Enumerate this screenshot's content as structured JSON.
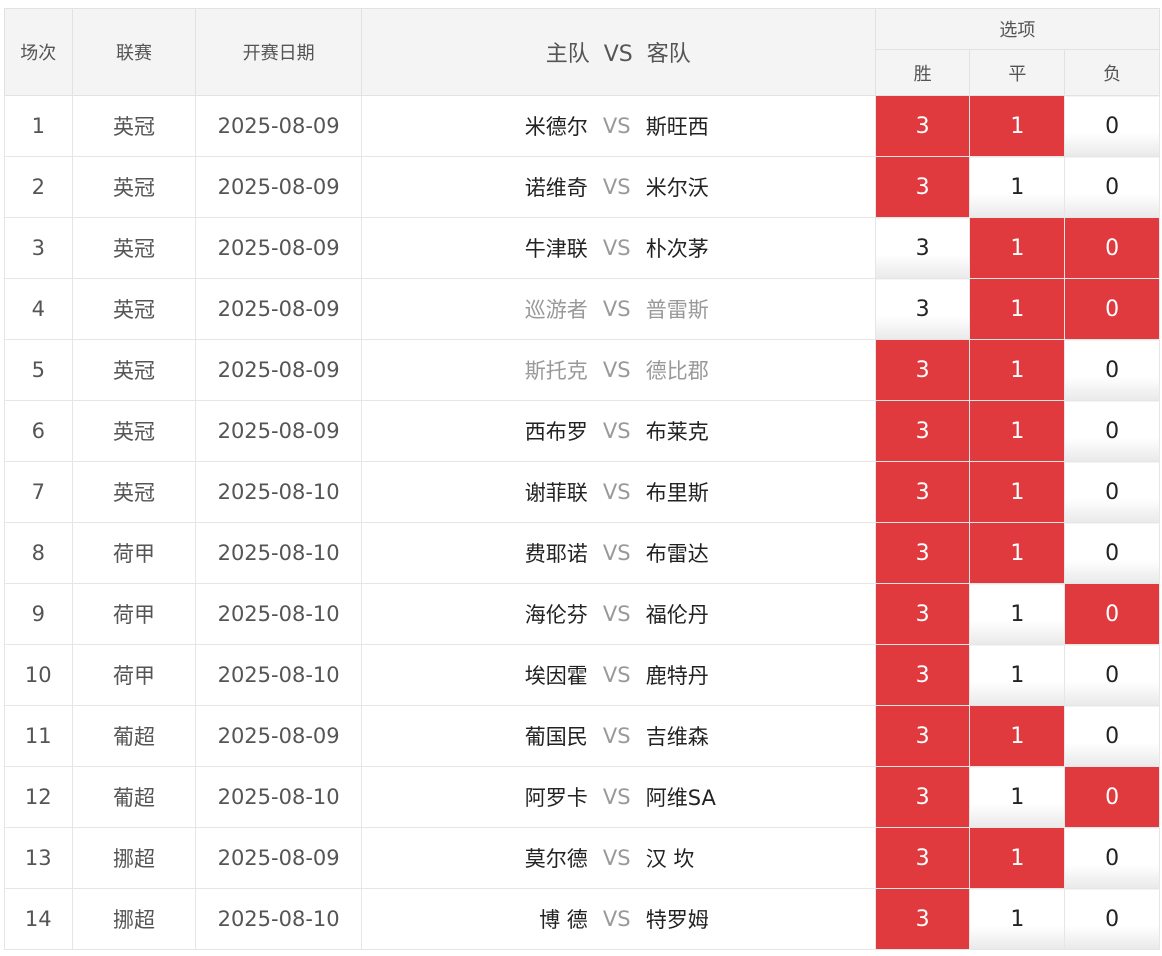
{
  "header": {
    "num": "场次",
    "league": "联赛",
    "date": "开赛日期",
    "home": "主队",
    "vs": "VS",
    "away": "客队",
    "options": "选项",
    "win": "胜",
    "draw": "平",
    "lose": "负"
  },
  "colors": {
    "selected": "#e03a3e",
    "muted": "#999999"
  },
  "rows": [
    {
      "num": "1",
      "league": "英冠",
      "date": "2025-08-09",
      "home": "米德尔",
      "away": "斯旺西",
      "muted": false,
      "w": "3",
      "d": "1",
      "l": "0",
      "sel": [
        true,
        true,
        false
      ]
    },
    {
      "num": "2",
      "league": "英冠",
      "date": "2025-08-09",
      "home": "诺维奇",
      "away": "米尔沃",
      "muted": false,
      "w": "3",
      "d": "1",
      "l": "0",
      "sel": [
        true,
        false,
        false
      ]
    },
    {
      "num": "3",
      "league": "英冠",
      "date": "2025-08-09",
      "home": "牛津联",
      "away": "朴次茅",
      "muted": false,
      "w": "3",
      "d": "1",
      "l": "0",
      "sel": [
        false,
        true,
        true
      ]
    },
    {
      "num": "4",
      "league": "英冠",
      "date": "2025-08-09",
      "home": "巡游者",
      "away": "普雷斯",
      "muted": true,
      "w": "3",
      "d": "1",
      "l": "0",
      "sel": [
        false,
        true,
        true
      ]
    },
    {
      "num": "5",
      "league": "英冠",
      "date": "2025-08-09",
      "home": "斯托克",
      "away": "德比郡",
      "muted": true,
      "w": "3",
      "d": "1",
      "l": "0",
      "sel": [
        true,
        true,
        false
      ]
    },
    {
      "num": "6",
      "league": "英冠",
      "date": "2025-08-09",
      "home": "西布罗",
      "away": "布莱克",
      "muted": false,
      "w": "3",
      "d": "1",
      "l": "0",
      "sel": [
        true,
        true,
        false
      ]
    },
    {
      "num": "7",
      "league": "英冠",
      "date": "2025-08-10",
      "home": "谢菲联",
      "away": "布里斯",
      "muted": false,
      "w": "3",
      "d": "1",
      "l": "0",
      "sel": [
        true,
        true,
        false
      ]
    },
    {
      "num": "8",
      "league": "荷甲",
      "date": "2025-08-10",
      "home": "费耶诺",
      "away": "布雷达",
      "muted": false,
      "w": "3",
      "d": "1",
      "l": "0",
      "sel": [
        true,
        true,
        false
      ]
    },
    {
      "num": "9",
      "league": "荷甲",
      "date": "2025-08-10",
      "home": "海伦芬",
      "away": "福伦丹",
      "muted": false,
      "w": "3",
      "d": "1",
      "l": "0",
      "sel": [
        true,
        false,
        true
      ]
    },
    {
      "num": "10",
      "league": "荷甲",
      "date": "2025-08-10",
      "home": "埃因霍",
      "away": "鹿特丹",
      "muted": false,
      "w": "3",
      "d": "1",
      "l": "0",
      "sel": [
        true,
        false,
        false
      ]
    },
    {
      "num": "11",
      "league": "葡超",
      "date": "2025-08-09",
      "home": "葡国民",
      "away": "吉维森",
      "muted": false,
      "w": "3",
      "d": "1",
      "l": "0",
      "sel": [
        true,
        true,
        false
      ]
    },
    {
      "num": "12",
      "league": "葡超",
      "date": "2025-08-10",
      "home": "阿罗卡",
      "away": "阿维SA",
      "muted": false,
      "w": "3",
      "d": "1",
      "l": "0",
      "sel": [
        true,
        false,
        true
      ]
    },
    {
      "num": "13",
      "league": "挪超",
      "date": "2025-08-09",
      "home": "莫尔德",
      "away": "汉 坎",
      "muted": false,
      "w": "3",
      "d": "1",
      "l": "0",
      "sel": [
        true,
        true,
        false
      ]
    },
    {
      "num": "14",
      "league": "挪超",
      "date": "2025-08-10",
      "home": "博 德",
      "away": "特罗姆",
      "muted": false,
      "w": "3",
      "d": "1",
      "l": "0",
      "sel": [
        true,
        false,
        false
      ]
    }
  ]
}
